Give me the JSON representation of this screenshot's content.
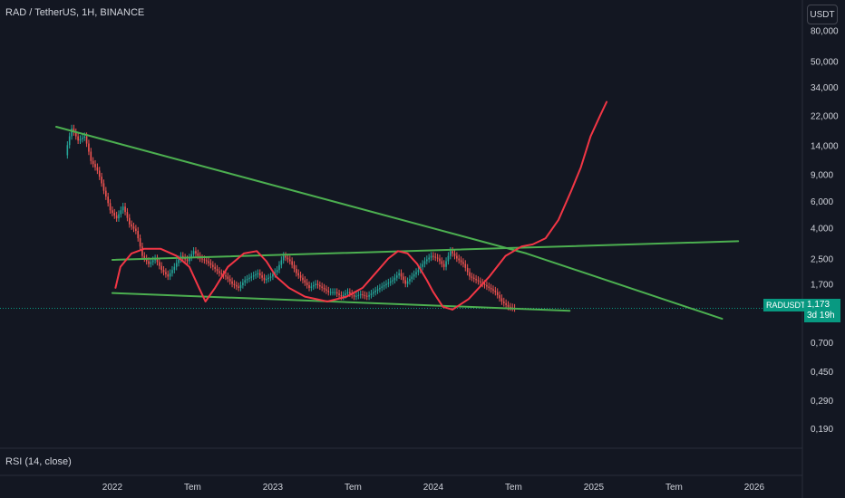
{
  "header": {
    "title": "RAD / TetherUS, 1H, BINANCE",
    "currency": "USDT"
  },
  "indicator": {
    "label": "RSI (14, close)"
  },
  "price_tag": {
    "symbol": "RADUSDT",
    "price": "1,173",
    "countdown": "3d 19h"
  },
  "colors": {
    "background": "#131722",
    "up": "#26a69a",
    "down": "#ef5350",
    "trendline": "#4caf50",
    "projection": "#f23645",
    "grid": "#1f2330",
    "axis_text": "#d1d4dc"
  },
  "chart_data": {
    "type": "line",
    "y_scale": "log",
    "ylim": [
      0.15,
      90
    ],
    "xlim": [
      2021.3,
      2026.3
    ],
    "y_ticks": [
      {
        "value": 80,
        "label": "80,000"
      },
      {
        "value": 50,
        "label": "50,000"
      },
      {
        "value": 34,
        "label": "34,000"
      },
      {
        "value": 22,
        "label": "22,000"
      },
      {
        "value": 14,
        "label": "14,000"
      },
      {
        "value": 9,
        "label": "9,000"
      },
      {
        "value": 6,
        "label": "6,000"
      },
      {
        "value": 4,
        "label": "4,000"
      },
      {
        "value": 2.5,
        "label": "2,500"
      },
      {
        "value": 1.7,
        "label": "1,700"
      },
      {
        "value": 0.7,
        "label": "0,700"
      },
      {
        "value": 0.45,
        "label": "0,450"
      },
      {
        "value": 0.29,
        "label": "0,290"
      },
      {
        "value": 0.19,
        "label": "0,190"
      }
    ],
    "x_ticks": [
      {
        "value": 2022.0,
        "label": "2022"
      },
      {
        "value": 2022.5,
        "label": "Tem"
      },
      {
        "value": 2023.0,
        "label": "2023"
      },
      {
        "value": 2023.5,
        "label": "Tem"
      },
      {
        "value": 2024.0,
        "label": "2024"
      },
      {
        "value": 2024.5,
        "label": "Tem"
      },
      {
        "value": 2025.0,
        "label": "2025"
      },
      {
        "value": 2025.5,
        "label": "Tem"
      },
      {
        "value": 2026.0,
        "label": "2026"
      }
    ],
    "current_price": 1.173,
    "series": [
      {
        "role": "price",
        "points": [
          [
            2021.72,
            12
          ],
          [
            2021.76,
            18
          ],
          [
            2021.8,
            15
          ],
          [
            2021.84,
            16
          ],
          [
            2021.88,
            11
          ],
          [
            2021.92,
            9.5
          ],
          [
            2021.96,
            7
          ],
          [
            2022.0,
            5.2
          ],
          [
            2022.04,
            4.6
          ],
          [
            2022.08,
            5.5
          ],
          [
            2022.12,
            4.2
          ],
          [
            2022.16,
            3.8
          ],
          [
            2022.2,
            2.6
          ],
          [
            2022.24,
            2.3
          ],
          [
            2022.28,
            2.5
          ],
          [
            2022.32,
            2.1
          ],
          [
            2022.36,
            1.9
          ],
          [
            2022.4,
            2.2
          ],
          [
            2022.44,
            2.6
          ],
          [
            2022.48,
            2.4
          ],
          [
            2022.52,
            2.8
          ],
          [
            2022.56,
            2.5
          ],
          [
            2022.6,
            2.4
          ],
          [
            2022.64,
            2.2
          ],
          [
            2022.68,
            2.0
          ],
          [
            2022.72,
            1.9
          ],
          [
            2022.76,
            1.7
          ],
          [
            2022.8,
            1.6
          ],
          [
            2022.84,
            1.8
          ],
          [
            2022.88,
            1.9
          ],
          [
            2022.92,
            2.0
          ],
          [
            2022.96,
            1.8
          ],
          [
            2023.0,
            1.9
          ],
          [
            2023.04,
            2.1
          ],
          [
            2023.08,
            2.6
          ],
          [
            2023.12,
            2.4
          ],
          [
            2023.16,
            2.0
          ],
          [
            2023.2,
            1.8
          ],
          [
            2023.24,
            1.6
          ],
          [
            2023.28,
            1.7
          ],
          [
            2023.32,
            1.6
          ],
          [
            2023.36,
            1.5
          ],
          [
            2023.4,
            1.5
          ],
          [
            2023.44,
            1.4
          ],
          [
            2023.48,
            1.5
          ],
          [
            2023.52,
            1.4
          ],
          [
            2023.56,
            1.45
          ],
          [
            2023.6,
            1.4
          ],
          [
            2023.64,
            1.5
          ],
          [
            2023.68,
            1.6
          ],
          [
            2023.72,
            1.7
          ],
          [
            2023.76,
            1.8
          ],
          [
            2023.8,
            2.0
          ],
          [
            2023.84,
            1.7
          ],
          [
            2023.88,
            1.9
          ],
          [
            2023.92,
            2.1
          ],
          [
            2023.96,
            2.4
          ],
          [
            2024.0,
            2.6
          ],
          [
            2024.04,
            2.5
          ],
          [
            2024.08,
            2.2
          ],
          [
            2024.12,
            2.8
          ],
          [
            2024.16,
            2.5
          ],
          [
            2024.2,
            2.3
          ],
          [
            2024.24,
            1.9
          ],
          [
            2024.28,
            1.8
          ],
          [
            2024.32,
            1.7
          ],
          [
            2024.36,
            1.6
          ],
          [
            2024.4,
            1.5
          ],
          [
            2024.44,
            1.3
          ],
          [
            2024.48,
            1.2
          ],
          [
            2024.52,
            1.17
          ]
        ]
      },
      {
        "role": "upper-resistance-trendline",
        "points": [
          [
            2021.65,
            18.5
          ],
          [
            2024.58,
            2.7
          ],
          [
            2025.8,
            1.0
          ]
        ]
      },
      {
        "role": "lower-support-trendline",
        "points": [
          [
            2022.0,
            1.48
          ],
          [
            2024.85,
            1.13
          ]
        ]
      },
      {
        "role": "neckline-trendline",
        "points": [
          [
            2022.0,
            2.45
          ],
          [
            2025.9,
            3.25
          ]
        ]
      },
      {
        "role": "cup-pattern-curves",
        "points": [
          [
            2022.02,
            1.6
          ],
          [
            2022.05,
            2.2
          ],
          [
            2022.12,
            2.7
          ],
          [
            2022.2,
            2.9
          ],
          [
            2022.3,
            2.9
          ],
          [
            2022.4,
            2.6
          ],
          [
            2022.48,
            2.2
          ],
          [
            2022.54,
            1.6
          ],
          [
            2022.58,
            1.3
          ],
          [
            2022.64,
            1.6
          ],
          [
            2022.72,
            2.2
          ],
          [
            2022.82,
            2.7
          ],
          [
            2022.9,
            2.8
          ],
          [
            2022.96,
            2.4
          ],
          [
            2023.02,
            1.9
          ],
          [
            2023.1,
            1.6
          ],
          [
            2023.2,
            1.4
          ],
          [
            2023.34,
            1.3
          ],
          [
            2023.46,
            1.4
          ],
          [
            2023.56,
            1.6
          ],
          [
            2023.64,
            2.0
          ],
          [
            2023.72,
            2.5
          ],
          [
            2023.78,
            2.8
          ],
          [
            2023.84,
            2.7
          ],
          [
            2023.9,
            2.3
          ],
          [
            2023.96,
            1.8
          ],
          [
            2024.0,
            1.5
          ],
          [
            2024.06,
            1.2
          ],
          [
            2024.12,
            1.15
          ]
        ]
      },
      {
        "role": "projection-curve",
        "points": [
          [
            2024.12,
            1.15
          ],
          [
            2024.22,
            1.35
          ],
          [
            2024.35,
            1.9
          ],
          [
            2024.45,
            2.6
          ],
          [
            2024.55,
            3.0
          ],
          [
            2024.62,
            3.1
          ],
          [
            2024.7,
            3.4
          ],
          [
            2024.78,
            4.5
          ],
          [
            2024.86,
            7.0
          ],
          [
            2024.92,
            10
          ],
          [
            2024.98,
            16
          ],
          [
            2025.04,
            22
          ],
          [
            2025.08,
            27
          ]
        ]
      }
    ]
  }
}
